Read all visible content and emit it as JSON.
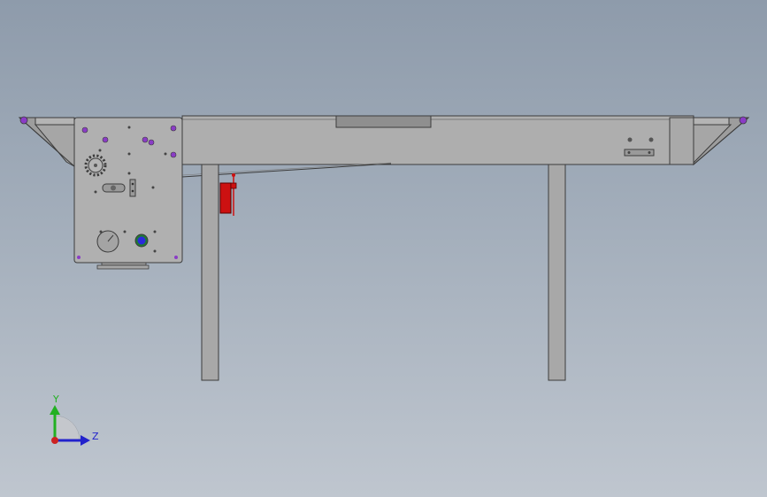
{
  "scene": {
    "background_top": "#8e9bab",
    "background_bottom": "#bfc6cf",
    "part_fill": "#aeaeae",
    "part_stroke": "#3c3c3c",
    "accent_purple": "#8a3cc6",
    "accent_red": "#cc1111"
  },
  "triad": {
    "y_label": "Y",
    "z_label": "Z",
    "y_color": "#22b022",
    "z_color": "#2222cc",
    "origin_color": "#cc2222"
  }
}
